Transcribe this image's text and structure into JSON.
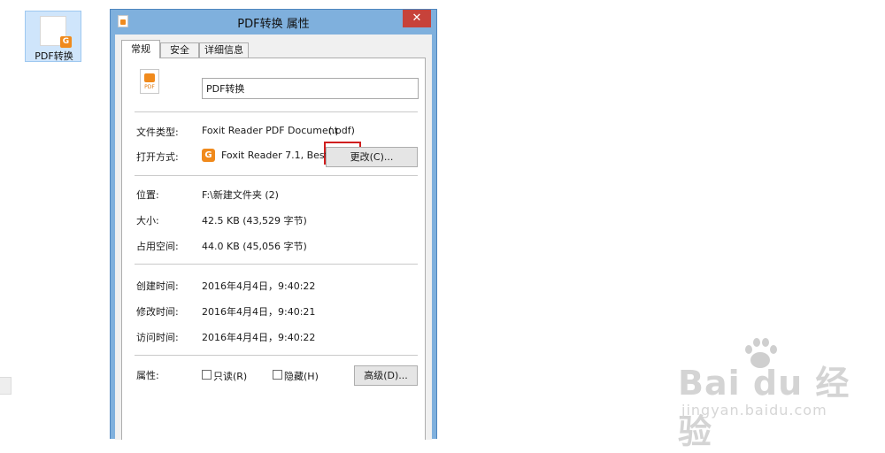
{
  "desktop": {
    "icon_label": "PDF转换"
  },
  "dialog": {
    "title": "PDF转换 属性",
    "close_glyph": "✕",
    "tabs": [
      "常规",
      "安全",
      "详细信息"
    ],
    "file_icon_text": "PDF",
    "file_name": "PDF转换",
    "type_label": "文件类型:",
    "type_value": "Foxit Reader PDF Document",
    "type_ext": "(.pdf)",
    "open_label": "打开方式:",
    "open_app": "Foxit Reader 7.1, Best",
    "change_button": "更改(C)...",
    "location_label": "位置:",
    "location_value": "F:\\新建文件夹 (2)",
    "size_label": "大小:",
    "size_value": "42.5 KB (43,529 字节)",
    "disk_label": "占用空间:",
    "disk_value": "44.0 KB (45,056 字节)",
    "created_label": "创建时间:",
    "created_value": "2016年4月4日，9:40:22",
    "modified_label": "修改时间:",
    "modified_value": "2016年4月4日，9:40:21",
    "accessed_label": "访问时间:",
    "accessed_value": "2016年4月4日，9:40:22",
    "attr_label": "属性:",
    "readonly_label": "只读(R)",
    "hidden_label": "隐藏(H)",
    "advanced_button": "高级(D)..."
  },
  "watermark": {
    "main": "Bai du 经验",
    "sub": "jingyan.baidu.com"
  },
  "colors": {
    "accent_highlight": "#d01f1f",
    "title_bar": "#7fb0dd",
    "close": "#c7423a",
    "foxit": "#f08a1c"
  }
}
